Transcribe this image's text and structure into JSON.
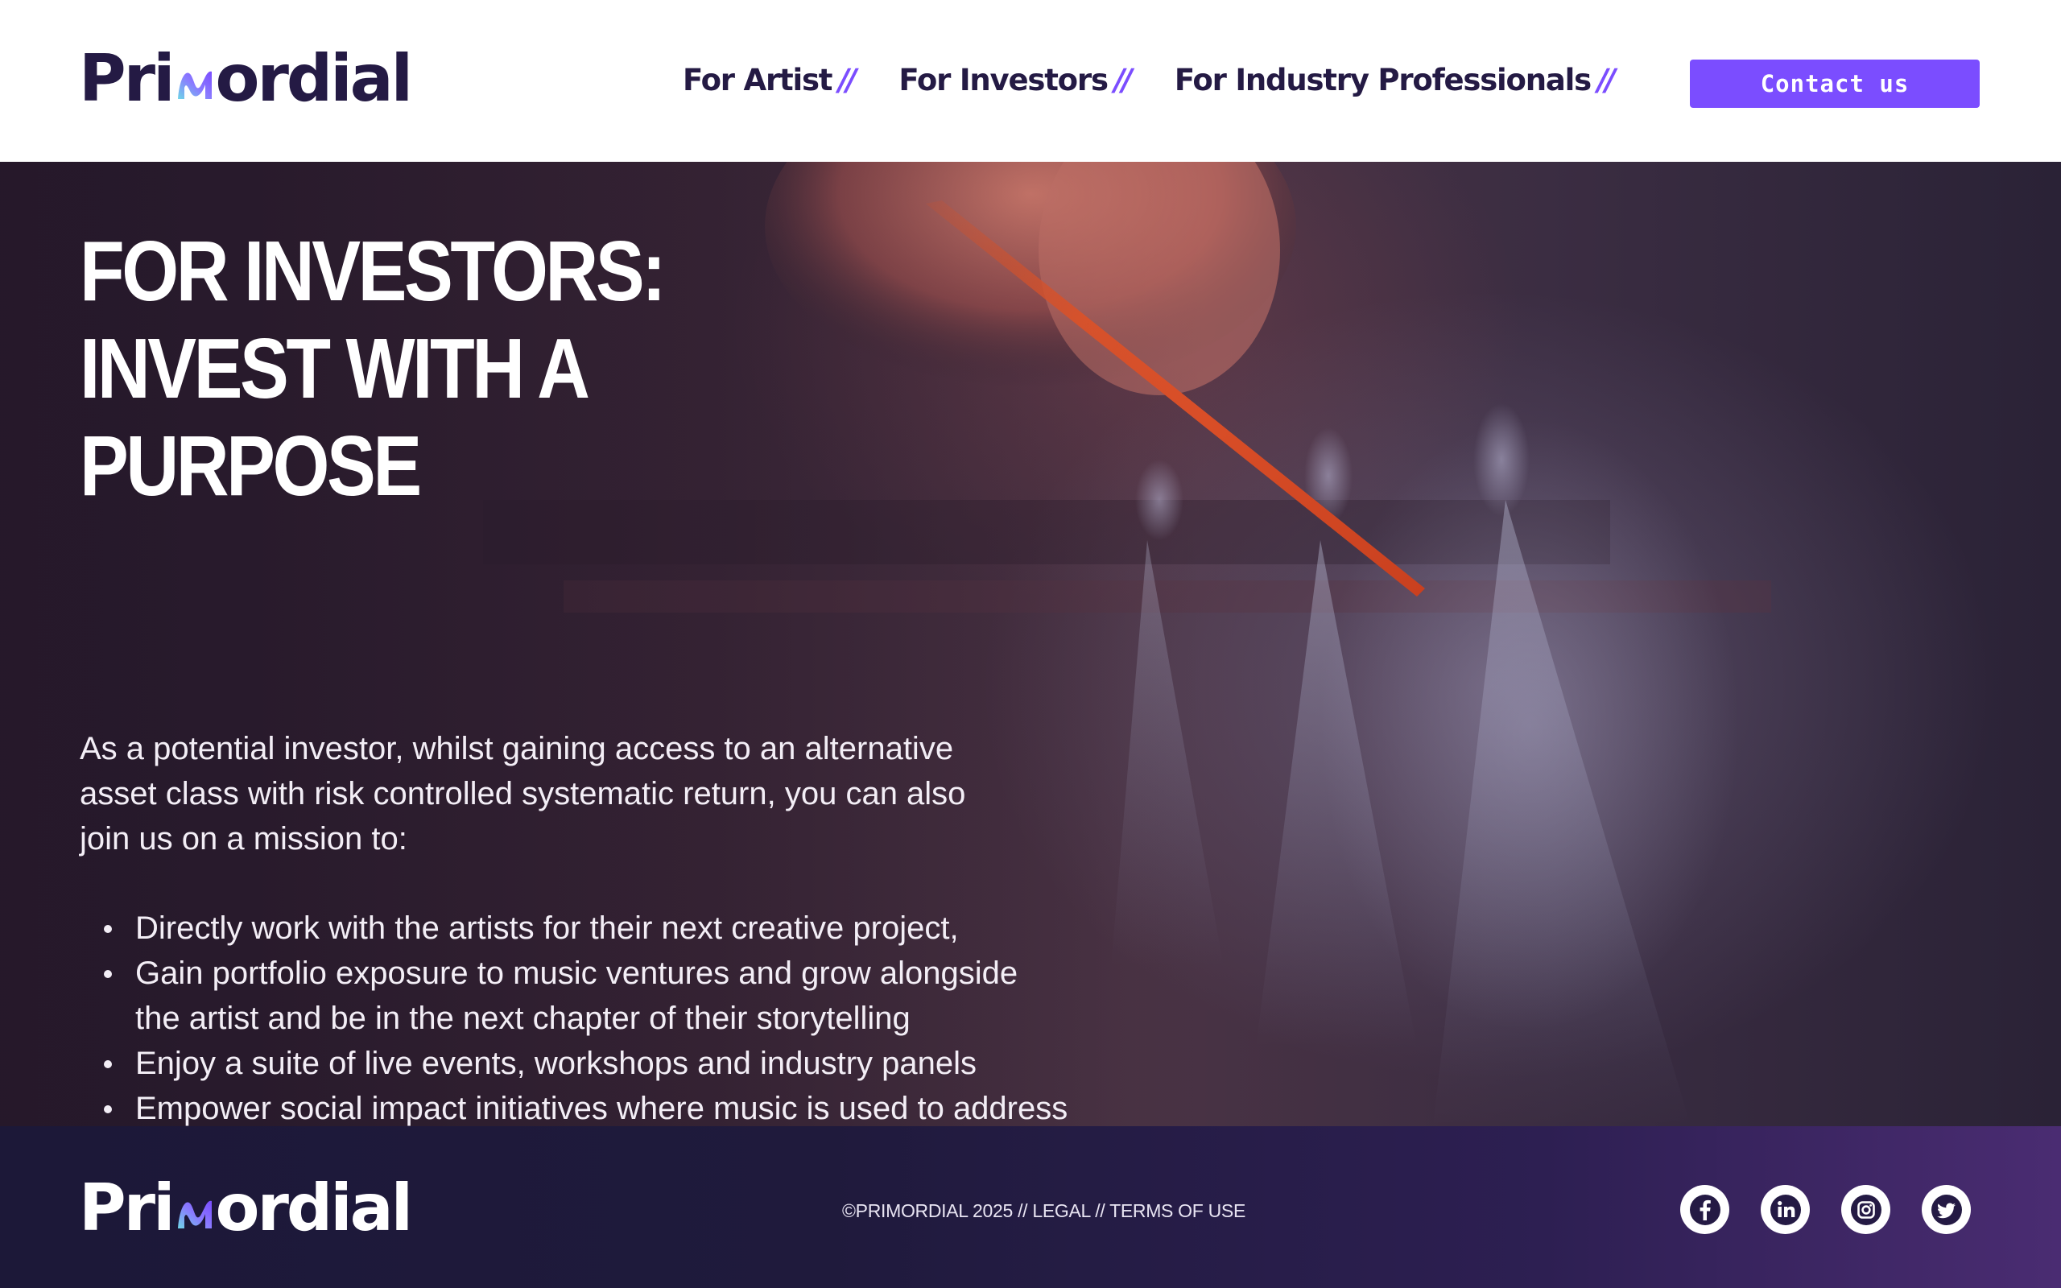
{
  "brand": {
    "name_prefix": "Pri",
    "name_suffix": "ordial"
  },
  "nav": {
    "items": [
      {
        "label": "For Artist",
        "separator": "//"
      },
      {
        "label": "For Investors",
        "separator": "//"
      },
      {
        "label": "For Industry Professionals",
        "separator": "//"
      }
    ],
    "contact_label": "Contact us"
  },
  "hero": {
    "title_lines": [
      "FOR INVESTORS:",
      "INVEST WITH A",
      "PURPOSE"
    ],
    "intro": "As a potential investor, whilst gaining access to an alternative asset class with risk controlled systematic return, you can also join us on a mission to:",
    "bullets": [
      "Directly work with the artists for their next creative project,",
      "Gain portfolio exposure to music ventures and grow alongside the artist and be in the next chapter of their storytelling",
      "Enjoy a suite of live events, workshops and industry panels",
      "Empower social impact initiatives where music is used to address societal and humanitarian issues"
    ]
  },
  "footer": {
    "legal_text": "©PRIMORDIAL 2025 // LEGAL // TERMS OF USE",
    "socials": [
      "facebook-icon",
      "linkedin-icon",
      "instagram-icon",
      "twitter-icon"
    ]
  },
  "colors": {
    "brand_dark": "#241a44",
    "accent": "#7b4dff",
    "footer_bg": "#1f1a3c"
  }
}
